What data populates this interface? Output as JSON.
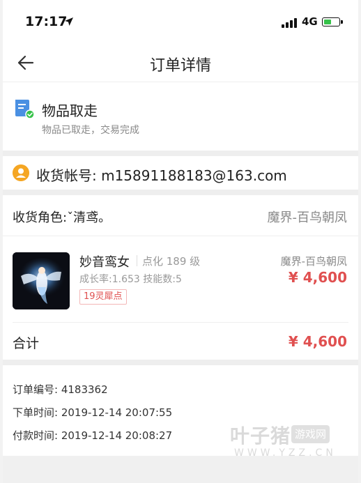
{
  "status_bar": {
    "time": "17:17",
    "network": "4G",
    "battery_level": 0.55,
    "battery_color": "#37c24a"
  },
  "nav": {
    "title": "订单详情",
    "back_icon": "arrow-left-icon"
  },
  "order_status": {
    "icon": "receipt-check-icon",
    "title": "物品取走",
    "subtitle": "物品已取走，交易完成"
  },
  "account": {
    "icon": "user-icon",
    "text": "收货帐号: m15891188183@163.com"
  },
  "role": {
    "label": "收货角色:ˇ清鸢。",
    "server": "魔界-百鸟朝凤"
  },
  "item": {
    "name": "妙音鸾女",
    "level": "点化 189 级",
    "stats": "成长率:1.653 技能数:5",
    "tag": "19灵犀点",
    "server": "魔界-百鸟朝凤",
    "price": "¥ 4,600"
  },
  "total": {
    "label": "合计",
    "price": "¥ 4,600"
  },
  "order_info": {
    "order_no": "订单编号: 4183362",
    "order_time": "下单时间: 2019-12-14 20:07:55",
    "pay_time": "付款时间: 2019-12-14 20:08:27"
  },
  "watermark": {
    "main": "叶子猪",
    "badge": "游戏网",
    "url": "WWW.YZZ.CN"
  },
  "colors": {
    "price_red": "#e05050",
    "accent_orange": "#f5a623",
    "icon_blue": "#4a90e2",
    "check_green": "#37c24a"
  }
}
